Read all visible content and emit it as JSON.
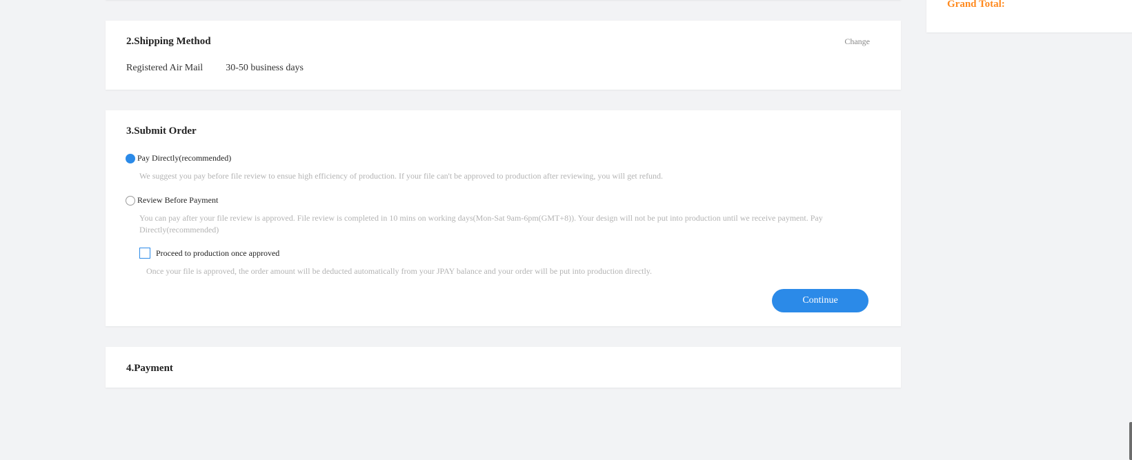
{
  "summary": {
    "grand_total_label": "Grand Total:"
  },
  "shipping": {
    "title": "2.Shipping Method",
    "change_label": "Change",
    "method": "Registered Air Mail",
    "duration": "30-50 business days"
  },
  "submit": {
    "title": "3.Submit Order",
    "options": [
      {
        "label": "Pay Directly(recommended)",
        "selected": true,
        "hint": "We suggest you pay before file review to ensue high efficiency of production. If your file can't be approved to production after reviewing, you will get refund."
      },
      {
        "label": "Review Before Payment",
        "selected": false,
        "hint": "You can pay after your file review is approved. File review is completed in 10 mins on working days(Mon-Sat 9am-6pm(GMT+8)). Your design will not be put into production until we receive payment. Pay Directly(recommended)"
      }
    ],
    "proceed_checkbox": {
      "label": "Proceed to production once approved",
      "checked": false,
      "hint": "Once your file is approved, the order amount will be deducted automatically from your JPAY balance and your order will be put into production directly."
    },
    "continue_label": "Continue"
  },
  "payment": {
    "title": "4.Payment"
  },
  "colors": {
    "accent": "#2b8ae8",
    "grand_total": "#ff8a1f",
    "background": "#f2f3f5",
    "hint_text": "#b3b3b3"
  }
}
